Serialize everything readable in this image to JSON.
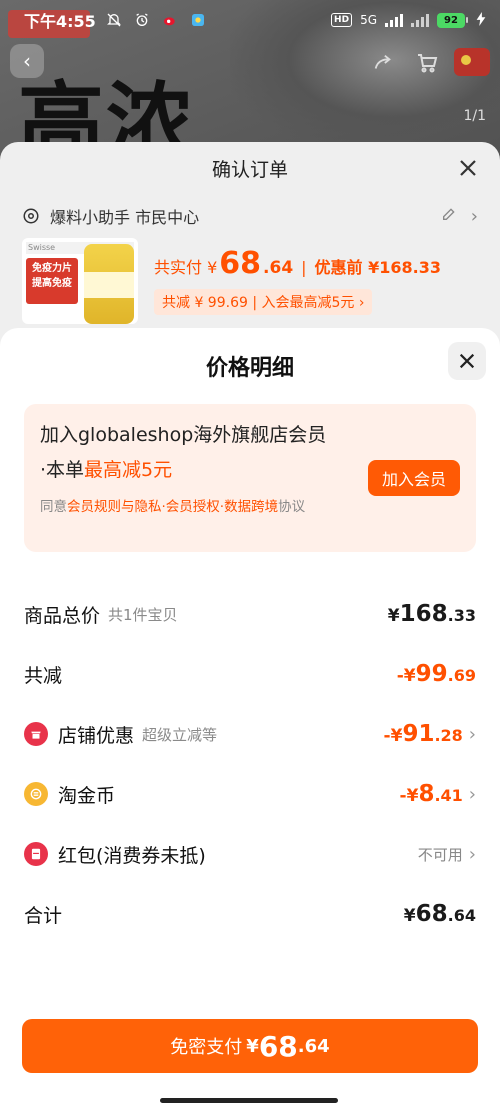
{
  "status_bar": {
    "time": "下午4:55",
    "network": "5G",
    "battery": "92"
  },
  "background": {
    "big_text": "高浓",
    "pager": "1/1"
  },
  "order": {
    "title": "确认订单",
    "address": "爆料小助手 市民中心",
    "product_thumb_brand": "Swisse",
    "product_thumb_promo": "免疫力片 提高免疫",
    "price_prefix": "共实付 ¥",
    "price_int": "68",
    "price_dec": ".64",
    "price_divider": "|",
    "price_before": "优惠前 ¥168.33",
    "saving_text": "共减 ¥ 99.69 | 入会最高减5元 ›"
  },
  "detail": {
    "title": "价格明细",
    "member": {
      "line1": "加入globaleshop海外旗舰店会员",
      "line2_prefix": "·本单",
      "line2_highlight": "最高减5元",
      "button": "加入会员",
      "agree_prefix": "同意",
      "agree_links": "会员规则与隐私·会员授权·数据跨境",
      "agree_suffix": "协议"
    },
    "rows": {
      "total": {
        "label": "商品总价",
        "sub": "共1件宝贝",
        "yen": "¥",
        "int": "168",
        "dec": ".33"
      },
      "reduce": {
        "label": "共减",
        "yen": "-¥",
        "int": "99",
        "dec": ".69"
      },
      "shop": {
        "label": "店铺优惠",
        "sub": "超级立减等",
        "yen": "-¥",
        "int": "91",
        "dec": ".28"
      },
      "coin": {
        "label": "淘金币",
        "yen": "-¥",
        "int": "8",
        "dec": ".41"
      },
      "redpacket": {
        "label": "红包(消费券未抵)",
        "value": "不可用"
      },
      "sum": {
        "label": "合计",
        "yen": "¥",
        "int": "68",
        "dec": ".64"
      }
    },
    "pay": {
      "label": "免密支付",
      "yen": "¥",
      "int": "68",
      "dec": ".64"
    }
  },
  "colors": {
    "accent": "#ff5000",
    "pay_button": "#ff6208",
    "member_bg": "#fff0e9",
    "shop_icon": "#e8334a",
    "coin_icon": "#f7b733",
    "redpacket_icon": "#e8334a"
  }
}
